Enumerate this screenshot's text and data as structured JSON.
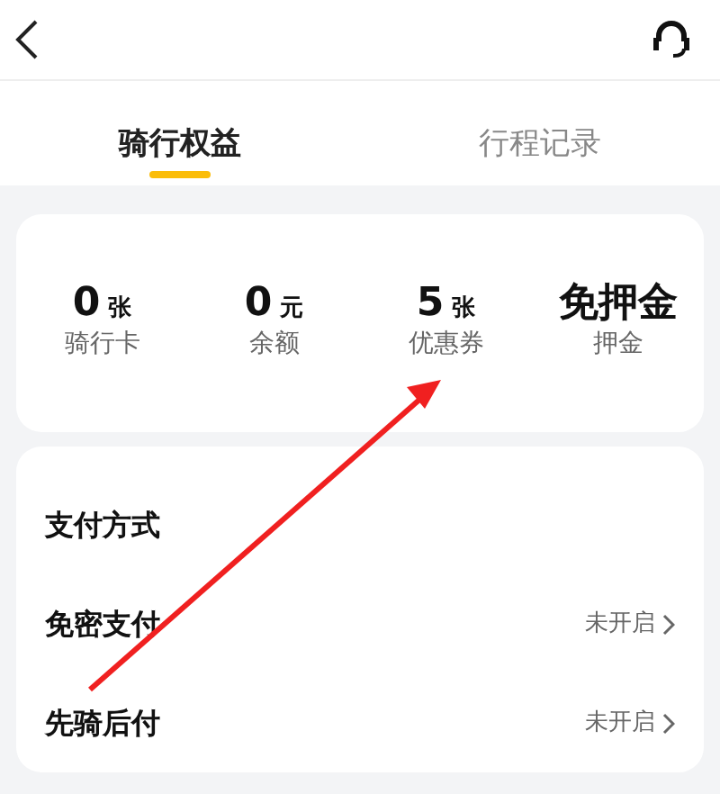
{
  "tabs": [
    {
      "label": "骑行权益",
      "selected": true
    },
    {
      "label": "行程记录",
      "selected": false
    }
  ],
  "stats": [
    {
      "value": "0",
      "unit": "张",
      "label": "骑行卡"
    },
    {
      "value": "0",
      "unit": "元",
      "label": "余额"
    },
    {
      "value": "5",
      "unit": "张",
      "label": "优惠券"
    },
    {
      "value": "免押金",
      "label": "押金"
    }
  ],
  "settings": [
    {
      "label": "支付方式"
    },
    {
      "label": "免密支付",
      "status": "未开启"
    },
    {
      "label": "先骑后付",
      "status": "未开启"
    }
  ]
}
